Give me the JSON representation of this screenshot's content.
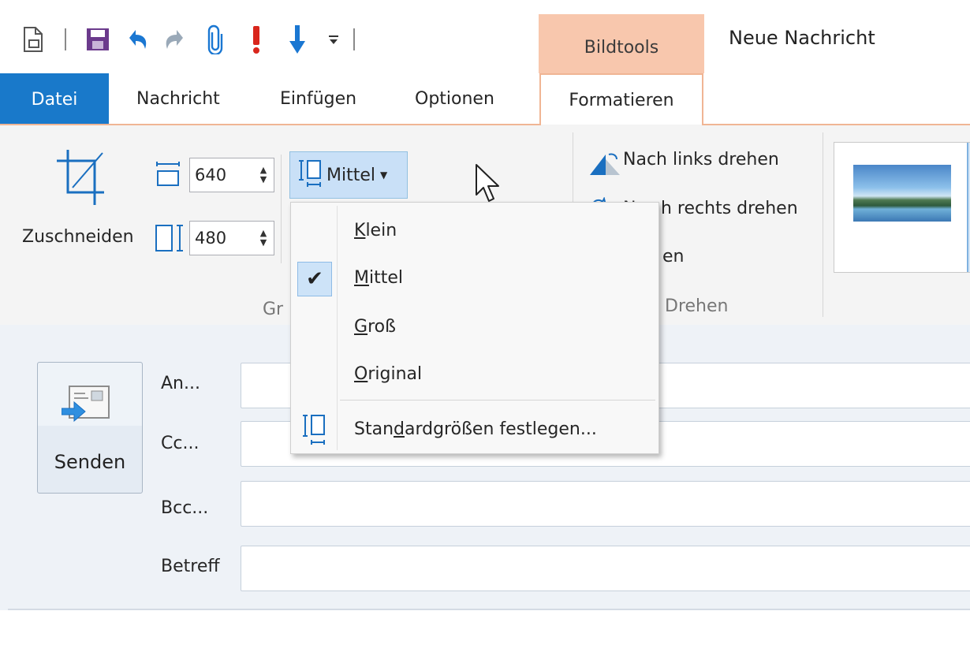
{
  "window": {
    "title": "Neue Nachricht",
    "context_tab_header": "Bildtools"
  },
  "quick_access": {
    "icons": [
      "new-item-icon",
      "save-icon",
      "undo-icon",
      "redo-icon",
      "attach-icon",
      "importance-high-icon",
      "importance-low-icon",
      "customize-qat-icon"
    ]
  },
  "tabs": {
    "datei": "Datei",
    "nachricht": "Nachricht",
    "einfuegen": "Einfügen",
    "optionen": "Optionen",
    "formatieren": "Formatieren"
  },
  "ribbon": {
    "crop_label": "Zuschneiden",
    "width_value": "640",
    "height_value": "480",
    "size_button_label": "Mittel",
    "group_size_label_visible": "Gr",
    "rotate_left": "Nach links drehen",
    "rotate_right_visible_start": "Na",
    "rotate_right_visible_end": "h rechts drehen",
    "flip_visible": "en",
    "group_rotate_label_visible": "Drehen"
  },
  "size_menu": {
    "items": [
      {
        "pre": "",
        "ul": "K",
        "post": "lein",
        "checked": false
      },
      {
        "pre": "",
        "ul": "M",
        "post": "ittel",
        "checked": true
      },
      {
        "pre": "",
        "ul": "G",
        "post": "roß",
        "checked": false
      },
      {
        "pre": "",
        "ul": "O",
        "post": "riginal",
        "checked": false
      }
    ],
    "default_sizes": {
      "pre": "Stan",
      "ul": "d",
      "post": "ardgrößen festlegen..."
    }
  },
  "compose": {
    "send_label": "Senden",
    "to_label": "An...",
    "cc_label": "Cc...",
    "bcc_label": "Bcc...",
    "subject_label": "Betreff",
    "to_value": "",
    "cc_value": "",
    "bcc_value": "",
    "subject_value": ""
  },
  "colors": {
    "accent_blue": "#1979ca",
    "context_tab_orange": "#f8c7ad",
    "tab_outline": "#f0b594",
    "menu_selected": "#cde3f8",
    "importance_red": "#d9261c"
  }
}
